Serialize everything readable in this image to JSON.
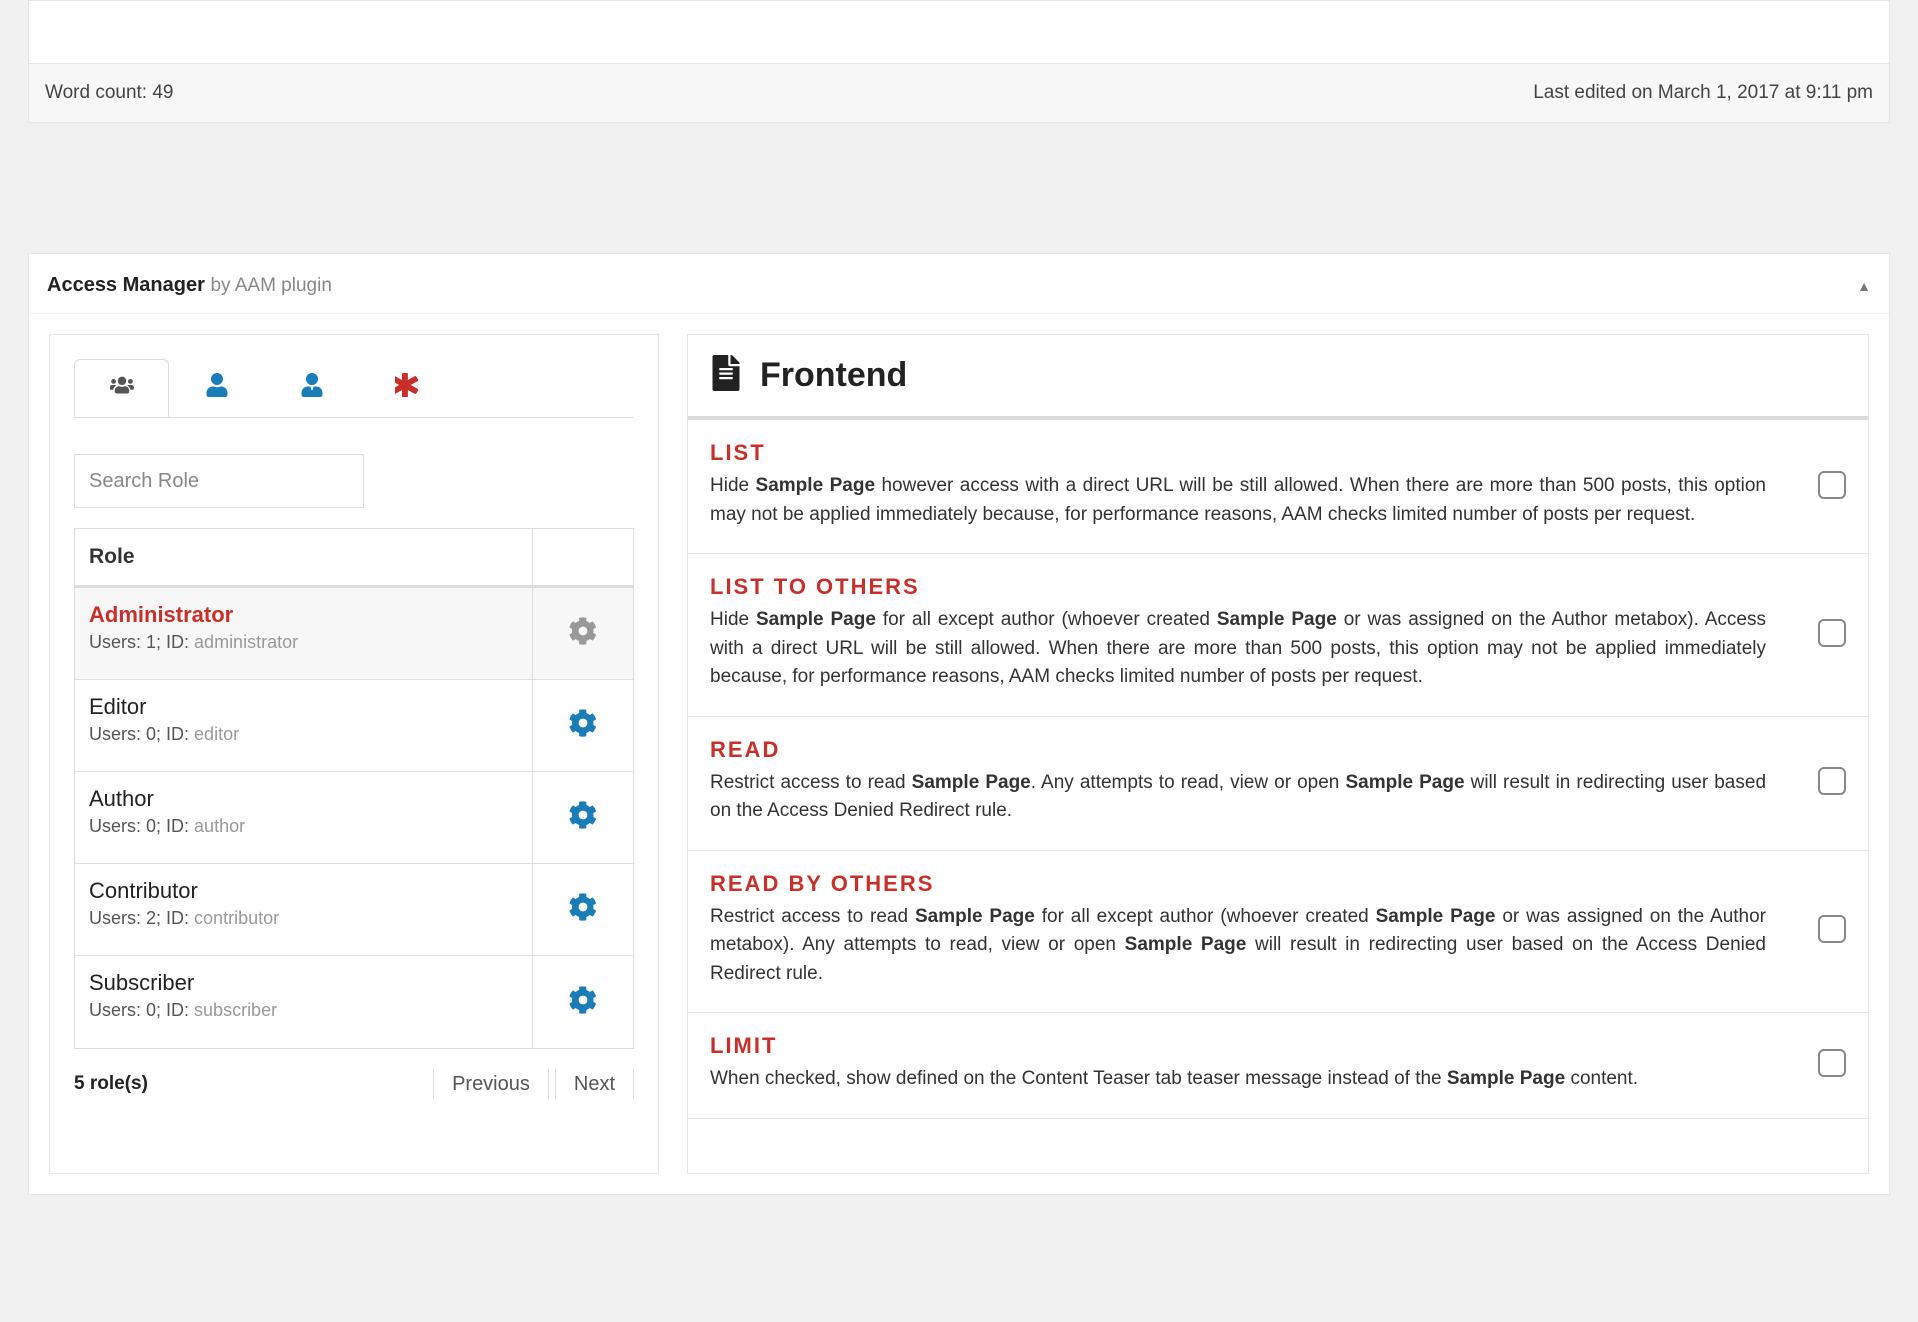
{
  "editor": {
    "word_count": "Word count: 49",
    "last_edited": "Last edited on March 1, 2017 at 9:11 pm"
  },
  "metabox": {
    "title": "Access Manager",
    "subtitle": "by AAM plugin"
  },
  "search": {
    "placeholder": "Search Role"
  },
  "roles_header": "Role",
  "roles": [
    {
      "name": "Administrator",
      "users": "1",
      "id": "administrator",
      "selected": true
    },
    {
      "name": "Editor",
      "users": "0",
      "id": "editor",
      "selected": false
    },
    {
      "name": "Author",
      "users": "0",
      "id": "author",
      "selected": false
    },
    {
      "name": "Contributor",
      "users": "2",
      "id": "contributor",
      "selected": false
    },
    {
      "name": "Subscriber",
      "users": "0",
      "id": "subscriber",
      "selected": false
    }
  ],
  "roles_footer": {
    "count": "5 role(s)",
    "prev": "Previous",
    "next": "Next"
  },
  "section_title": "Frontend",
  "labels": {
    "users_prefix": "Users: ",
    "id_prefix": "; ID: "
  },
  "options": [
    {
      "label": "LIST",
      "desc": "Hide <b>Sample Page</b> however access with a direct URL will be still allowed. When there are more than 500 posts, this option may not be applied immediately because, for performance reasons, AAM checks limited number of posts per request."
    },
    {
      "label": "LIST TO OTHERS",
      "desc": "Hide <b>Sample Page</b> for all except author (whoever created <b>Sample Page</b> or was assigned on the Author metabox). Access with a direct URL will be still allowed. When there are more than 500 posts, this option may not be applied immediately because, for performance reasons, AAM checks limited number of posts per request."
    },
    {
      "label": "READ",
      "desc": "Restrict access to read <b>Sample Page</b>. Any attempts to read, view or open <b>Sample Page</b> will result in redirecting user based on the Access Denied Redirect rule."
    },
    {
      "label": "READ BY OTHERS",
      "desc": "Restrict access to read <b>Sample Page</b> for all except author (whoever created <b>Sample Page</b> or was assigned on the Author metabox). Any attempts to read, view or open <b>Sample Page</b> will result in redirecting user based on the Access Denied Redirect rule."
    },
    {
      "label": "LIMIT",
      "desc": "When checked, show defined on the Content Teaser tab teaser message instead of the <b>Sample Page</b> content."
    }
  ]
}
